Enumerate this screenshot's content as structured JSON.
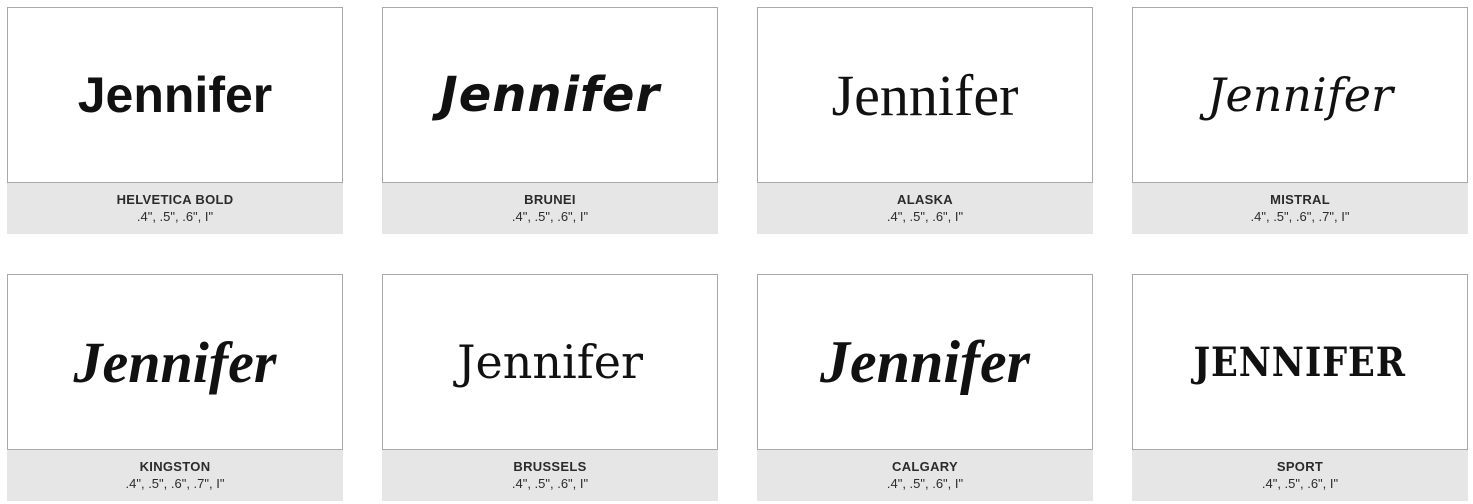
{
  "fonts": [
    {
      "sample": "Jennifer",
      "name": "HELVETICA BOLD",
      "sizes": ".4\", .5\", .6\", I\""
    },
    {
      "sample": "Jennifer",
      "name": "BRUNEI",
      "sizes": ".4\", .5\", .6\", I\""
    },
    {
      "sample": "Jennifer",
      "name": "ALASKA",
      "sizes": ".4\", .5\", .6\", I\""
    },
    {
      "sample": "Jennifer",
      "name": "MISTRAL",
      "sizes": ".4\", .5\", .6\", .7\", I\""
    },
    {
      "sample": "Jennifer",
      "name": "KINGSTON",
      "sizes": ".4\", .5\", .6\", .7\", I\""
    },
    {
      "sample": "Jennifer",
      "name": "BRUSSELS",
      "sizes": ".4\", .5\", .6\", I\""
    },
    {
      "sample": "Jennifer",
      "name": "CALGARY",
      "sizes": ".4\", .5\", .6\", I\""
    },
    {
      "sample": "JENNIFER",
      "name": "SPORT",
      "sizes": ".4\", .5\", .6\", I\""
    }
  ]
}
